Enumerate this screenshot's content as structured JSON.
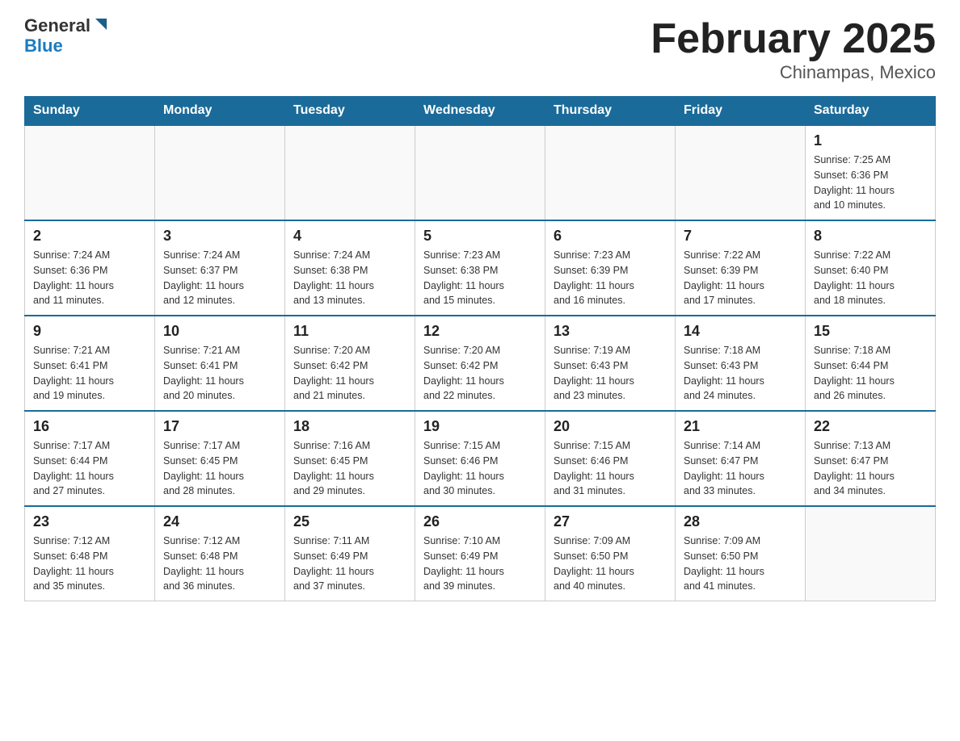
{
  "header": {
    "logo_line1": "General",
    "logo_line2": "Blue",
    "title": "February 2025",
    "subtitle": "Chinampas, Mexico"
  },
  "weekdays": [
    "Sunday",
    "Monday",
    "Tuesday",
    "Wednesday",
    "Thursday",
    "Friday",
    "Saturday"
  ],
  "weeks": [
    [
      {
        "day": "",
        "info": ""
      },
      {
        "day": "",
        "info": ""
      },
      {
        "day": "",
        "info": ""
      },
      {
        "day": "",
        "info": ""
      },
      {
        "day": "",
        "info": ""
      },
      {
        "day": "",
        "info": ""
      },
      {
        "day": "1",
        "info": "Sunrise: 7:25 AM\nSunset: 6:36 PM\nDaylight: 11 hours\nand 10 minutes."
      }
    ],
    [
      {
        "day": "2",
        "info": "Sunrise: 7:24 AM\nSunset: 6:36 PM\nDaylight: 11 hours\nand 11 minutes."
      },
      {
        "day": "3",
        "info": "Sunrise: 7:24 AM\nSunset: 6:37 PM\nDaylight: 11 hours\nand 12 minutes."
      },
      {
        "day": "4",
        "info": "Sunrise: 7:24 AM\nSunset: 6:38 PM\nDaylight: 11 hours\nand 13 minutes."
      },
      {
        "day": "5",
        "info": "Sunrise: 7:23 AM\nSunset: 6:38 PM\nDaylight: 11 hours\nand 15 minutes."
      },
      {
        "day": "6",
        "info": "Sunrise: 7:23 AM\nSunset: 6:39 PM\nDaylight: 11 hours\nand 16 minutes."
      },
      {
        "day": "7",
        "info": "Sunrise: 7:22 AM\nSunset: 6:39 PM\nDaylight: 11 hours\nand 17 minutes."
      },
      {
        "day": "8",
        "info": "Sunrise: 7:22 AM\nSunset: 6:40 PM\nDaylight: 11 hours\nand 18 minutes."
      }
    ],
    [
      {
        "day": "9",
        "info": "Sunrise: 7:21 AM\nSunset: 6:41 PM\nDaylight: 11 hours\nand 19 minutes."
      },
      {
        "day": "10",
        "info": "Sunrise: 7:21 AM\nSunset: 6:41 PM\nDaylight: 11 hours\nand 20 minutes."
      },
      {
        "day": "11",
        "info": "Sunrise: 7:20 AM\nSunset: 6:42 PM\nDaylight: 11 hours\nand 21 minutes."
      },
      {
        "day": "12",
        "info": "Sunrise: 7:20 AM\nSunset: 6:42 PM\nDaylight: 11 hours\nand 22 minutes."
      },
      {
        "day": "13",
        "info": "Sunrise: 7:19 AM\nSunset: 6:43 PM\nDaylight: 11 hours\nand 23 minutes."
      },
      {
        "day": "14",
        "info": "Sunrise: 7:18 AM\nSunset: 6:43 PM\nDaylight: 11 hours\nand 24 minutes."
      },
      {
        "day": "15",
        "info": "Sunrise: 7:18 AM\nSunset: 6:44 PM\nDaylight: 11 hours\nand 26 minutes."
      }
    ],
    [
      {
        "day": "16",
        "info": "Sunrise: 7:17 AM\nSunset: 6:44 PM\nDaylight: 11 hours\nand 27 minutes."
      },
      {
        "day": "17",
        "info": "Sunrise: 7:17 AM\nSunset: 6:45 PM\nDaylight: 11 hours\nand 28 minutes."
      },
      {
        "day": "18",
        "info": "Sunrise: 7:16 AM\nSunset: 6:45 PM\nDaylight: 11 hours\nand 29 minutes."
      },
      {
        "day": "19",
        "info": "Sunrise: 7:15 AM\nSunset: 6:46 PM\nDaylight: 11 hours\nand 30 minutes."
      },
      {
        "day": "20",
        "info": "Sunrise: 7:15 AM\nSunset: 6:46 PM\nDaylight: 11 hours\nand 31 minutes."
      },
      {
        "day": "21",
        "info": "Sunrise: 7:14 AM\nSunset: 6:47 PM\nDaylight: 11 hours\nand 33 minutes."
      },
      {
        "day": "22",
        "info": "Sunrise: 7:13 AM\nSunset: 6:47 PM\nDaylight: 11 hours\nand 34 minutes."
      }
    ],
    [
      {
        "day": "23",
        "info": "Sunrise: 7:12 AM\nSunset: 6:48 PM\nDaylight: 11 hours\nand 35 minutes."
      },
      {
        "day": "24",
        "info": "Sunrise: 7:12 AM\nSunset: 6:48 PM\nDaylight: 11 hours\nand 36 minutes."
      },
      {
        "day": "25",
        "info": "Sunrise: 7:11 AM\nSunset: 6:49 PM\nDaylight: 11 hours\nand 37 minutes."
      },
      {
        "day": "26",
        "info": "Sunrise: 7:10 AM\nSunset: 6:49 PM\nDaylight: 11 hours\nand 39 minutes."
      },
      {
        "day": "27",
        "info": "Sunrise: 7:09 AM\nSunset: 6:50 PM\nDaylight: 11 hours\nand 40 minutes."
      },
      {
        "day": "28",
        "info": "Sunrise: 7:09 AM\nSunset: 6:50 PM\nDaylight: 11 hours\nand 41 minutes."
      },
      {
        "day": "",
        "info": ""
      }
    ]
  ]
}
